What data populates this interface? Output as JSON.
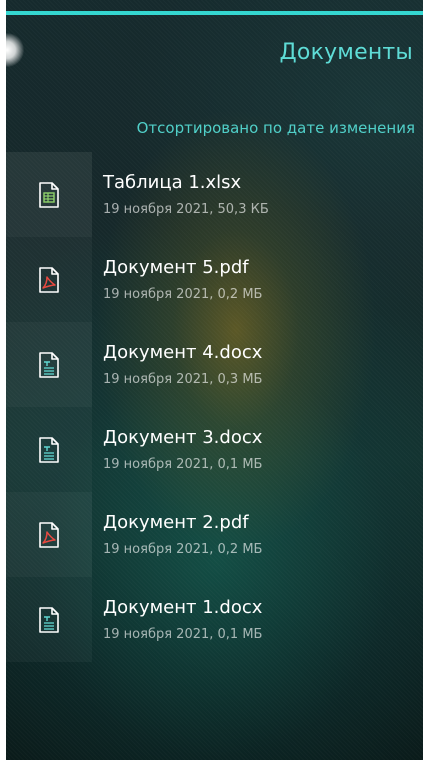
{
  "header": {
    "title": "Документы"
  },
  "sort": {
    "label": "Отсортировано по дате изменения"
  },
  "colors": {
    "accent": "#33d6d0",
    "title": "#5ddcd6",
    "pdf": "#e8483f",
    "doc": "#5fd7d1",
    "sheet": "#8fd36a"
  },
  "files": [
    {
      "name": "Таблица 1.xlsx",
      "meta": "19 ноября 2021, 50,3 КБ",
      "icon": "spreadsheet-icon"
    },
    {
      "name": "Документ 5.pdf",
      "meta": "19 ноября 2021, 0,2 МБ",
      "icon": "pdf-icon"
    },
    {
      "name": "Документ 4.docx",
      "meta": "19 ноября 2021, 0,3 МБ",
      "icon": "text-document-icon"
    },
    {
      "name": "Документ 3.docx",
      "meta": "19 ноября 2021, 0,1 МБ",
      "icon": "text-document-icon"
    },
    {
      "name": "Документ 2.pdf",
      "meta": "19 ноября 2021, 0,2 МБ",
      "icon": "pdf-icon"
    },
    {
      "name": "Документ 1.docx",
      "meta": "19 ноября 2021, 0,1 МБ",
      "icon": "text-document-icon"
    }
  ]
}
